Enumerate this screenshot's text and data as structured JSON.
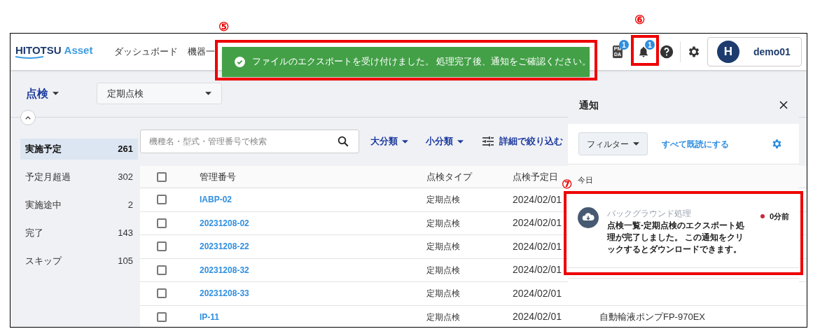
{
  "annotations": [
    {
      "label": "⑤"
    },
    {
      "label": "⑥"
    },
    {
      "label": "⑦"
    }
  ],
  "header": {
    "logo": {
      "main": "HITOTSU",
      "accent": "Asset"
    },
    "nav": [
      "ダッシュボード",
      "機器一"
    ],
    "pmda_icon": {
      "lines": [
        "PM",
        "DA"
      ],
      "badge": "1"
    },
    "bell_badge": "1",
    "user": {
      "initial": "H",
      "name": "demo01"
    }
  },
  "toast": {
    "message": "ファイルのエクスポートを受け付けました。 処理完了後、通知をご確認ください。"
  },
  "page": {
    "title": "点検",
    "type_select": "定期点検"
  },
  "sidebar": {
    "items": [
      {
        "label": "実施予定",
        "count": "261",
        "selected": true
      },
      {
        "label": "予定月超過",
        "count": "302",
        "selected": false
      },
      {
        "label": "実施途中",
        "count": "2",
        "selected": false
      },
      {
        "label": "完了",
        "count": "143",
        "selected": false
      },
      {
        "label": "スキップ",
        "count": "105",
        "selected": false
      }
    ]
  },
  "filters": {
    "search_placeholder": "機種名・型式・管理番号で検索",
    "dropdowns": [
      "大分類",
      "小分類"
    ],
    "detail": "詳細で絞り込む"
  },
  "table": {
    "header_checked": false,
    "columns": [
      "管理番号",
      "点検タイプ",
      "点検予定日"
    ],
    "rows": [
      {
        "checked": false,
        "id": "IABP-02",
        "type": "定期点検",
        "date": "2024/02/01"
      },
      {
        "checked": false,
        "id": "20231208-02",
        "type": "定期点検",
        "date": "2024/02/01"
      },
      {
        "checked": false,
        "id": "20231208-22",
        "type": "定期点検",
        "date": "2024/02/01"
      },
      {
        "checked": false,
        "id": "20231208-32",
        "type": "定期点検",
        "date": "2024/02/01"
      },
      {
        "checked": false,
        "id": "20231208-33",
        "type": "定期点検",
        "date": "2024/02/01"
      },
      {
        "checked": false,
        "id": "IP-11",
        "type": "定期点検",
        "date": "2024/02/01",
        "column_4": "自動輸液ポンプFP-970EX"
      }
    ]
  },
  "notifications": {
    "title": "通知",
    "filter": "フィルター",
    "mark_all_read": "すべて既読にする",
    "groups": [
      {
        "label": "今日",
        "items": [
          {
            "category": "バックグラウンド処理",
            "message": "点検一覧-定期点検のエクスポート処理が完了しました。 この通知をクリックするとダウンロードできます。",
            "time": "0分前",
            "unread": true
          }
        ]
      }
    ]
  }
}
